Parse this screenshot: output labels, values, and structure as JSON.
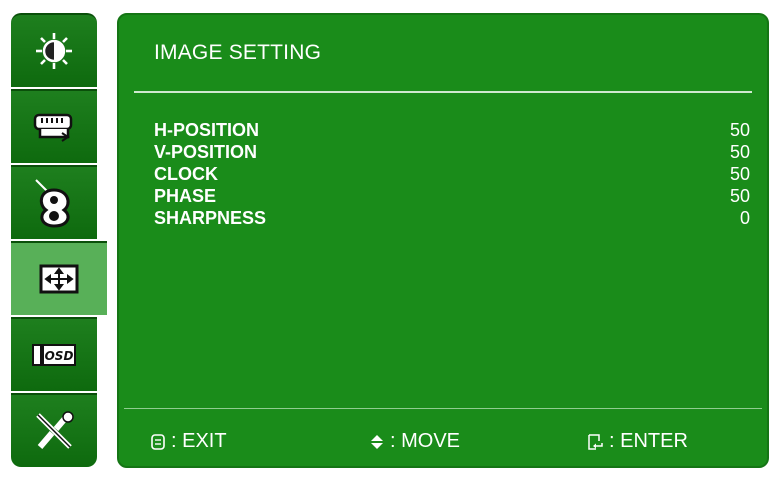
{
  "sidebar": {
    "tabs": [
      {
        "icon": "brightness-icon"
      },
      {
        "icon": "input-source-icon"
      },
      {
        "icon": "color-icon"
      },
      {
        "icon": "image-setting-icon",
        "active": true
      },
      {
        "icon": "osd-settings-icon"
      },
      {
        "icon": "tools-icon"
      }
    ]
  },
  "panel": {
    "title": "IMAGE SETTING",
    "items": [
      {
        "label": "H-POSITION",
        "value": "50"
      },
      {
        "label": "V-POSITION",
        "value": "50"
      },
      {
        "label": "CLOCK",
        "value": "50"
      },
      {
        "label": "PHASE",
        "value": "50"
      },
      {
        "label": "SHARPNESS",
        "value": "0"
      }
    ]
  },
  "footer": {
    "exit_label": ": EXIT",
    "move_label": ": MOVE",
    "enter_label": ": ENTER"
  },
  "colors": {
    "panel_bg": "#1a8c1a",
    "sidebar_bg": "#1e7f1e",
    "active_tab_bg": "#58b058",
    "text": "#ffffff"
  }
}
